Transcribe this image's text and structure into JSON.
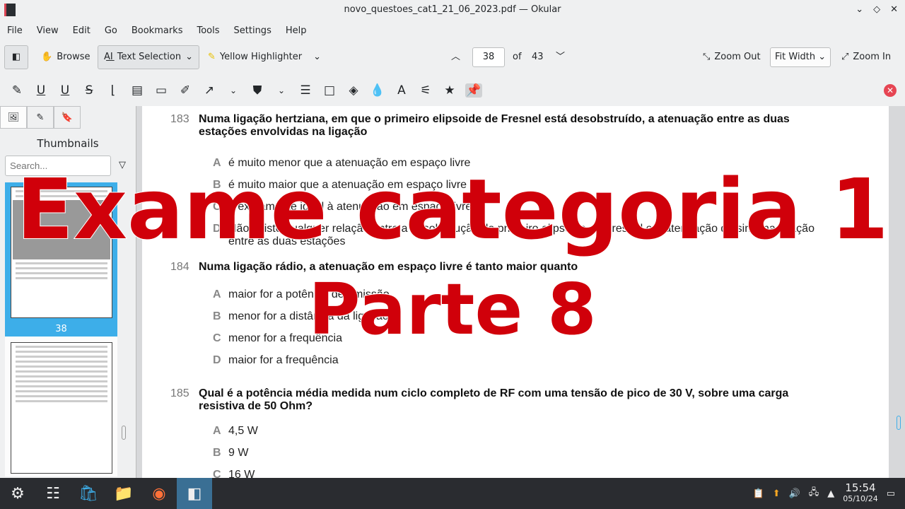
{
  "window": {
    "title": "novo_questoes_cat1_21_06_2023.pdf — Okular"
  },
  "menu": [
    "File",
    "View",
    "Edit",
    "Go",
    "Bookmarks",
    "Tools",
    "Settings",
    "Help"
  ],
  "toolbar": {
    "browse": "Browse",
    "text_selection": "Text Selection",
    "highlighter": "Yellow Highlighter",
    "page": "38",
    "of": "of",
    "total": "43",
    "zoom_out": "Zoom Out",
    "zoom_mode": "Fit Width",
    "zoom_in": "Zoom In"
  },
  "sidebar": {
    "title": "Thumbnails",
    "search_placeholder": "Search...",
    "current_page": "38"
  },
  "questions": [
    {
      "num": "183",
      "text": "Numa ligação hertziana, em que o primeiro elipsoide de Fresnel está desobstruído, a atenuação entre as duas estações envolvidas na ligação",
      "options": [
        {
          "l": "A",
          "t": "é muito menor que a atenuação em espaço livre"
        },
        {
          "l": "B",
          "t": "é muito maior que a atenuação em espaço livre"
        },
        {
          "l": "C",
          "t": "é exatamente igual à atenuação em espaço livre"
        },
        {
          "l": "D",
          "t": "Não existe qualquer relação entre a desobstrução do primeiro elipsoide de Fresnel e a atenuação do sinal na ligação entre as duas estações"
        }
      ]
    },
    {
      "num": "184",
      "text": "Numa ligação rádio, a atenuação em espaço livre é tanto maior quanto",
      "options": [
        {
          "l": "A",
          "t": "maior for a potência de emissão"
        },
        {
          "l": "B",
          "t": "menor for a distância da ligação"
        },
        {
          "l": "C",
          "t": "menor for a frequência"
        },
        {
          "l": "D",
          "t": "maior for a frequência"
        }
      ]
    },
    {
      "num": "185",
      "text": "Qual é a potência média medida num ciclo completo de RF com uma tensão de pico de 30 V, sobre uma carga resistiva de 50 Ohm?",
      "options": [
        {
          "l": "A",
          "t": "4,5 W"
        },
        {
          "l": "B",
          "t": "9 W"
        },
        {
          "l": "C",
          "t": "16 W"
        }
      ]
    }
  ],
  "overlay": {
    "line1": "Exame categoria 1",
    "line2": "Parte 8",
    "color": "#d0000a"
  },
  "taskbar": {
    "time": "15:54",
    "date": "05/10/24"
  }
}
